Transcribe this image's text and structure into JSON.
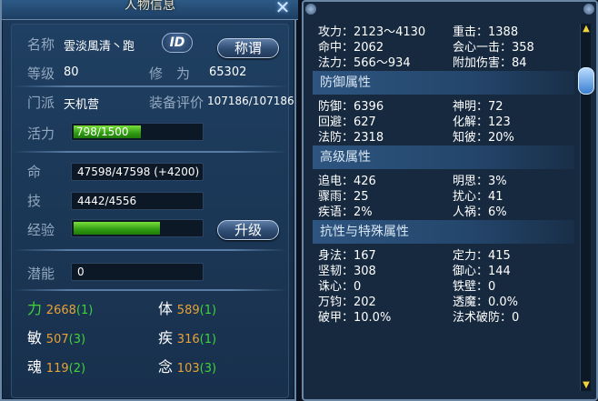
{
  "window": {
    "title": "人物信息",
    "close_icon": "close-x"
  },
  "profile": {
    "name_label": "名称",
    "name_value": "雲淡風清丶跑",
    "id_badge": "ID",
    "title_button": "称谓",
    "level_label": "等级",
    "level_value": "80",
    "cultivation_label": "修　为",
    "cultivation_value": "65302",
    "sect_label": "门派",
    "sect_value": "天机营",
    "gear_label": "装备评价",
    "gear_value": "107186/107186",
    "vitality_label": "活力",
    "vitality_value": "798/1500",
    "vitality_ratio": 0.532
  },
  "vitals": {
    "hp_label": "命",
    "hp_value": "47598/47598 (+4200)",
    "skill_label": "技",
    "skill_value": "4442/4556",
    "exp_label": "经验",
    "exp_ratio": 0.68,
    "upgrade_button": "升级",
    "potential_label": "潜能",
    "potential_value": "0"
  },
  "attributes": [
    {
      "name": "力",
      "value": "2668",
      "bonus": "(1)",
      "name_color": "#3fd43a"
    },
    {
      "name": "体",
      "value": "589",
      "bonus": "(1)",
      "name_color": "#ffffff"
    },
    {
      "name": "敏",
      "value": "507",
      "bonus": "(3)",
      "name_color": "#ffffff"
    },
    {
      "name": "疾",
      "value": "316",
      "bonus": "(1)",
      "name_color": "#ffffff"
    },
    {
      "name": "魂",
      "value": "119",
      "bonus": "(2)",
      "name_color": "#ffffff"
    },
    {
      "name": "念",
      "value": "103",
      "bonus": "(3)",
      "name_color": "#ffffff"
    }
  ],
  "colors": {
    "attr_value": "#e8a23a",
    "attr_bonus": "#3fd43a"
  },
  "stats": {
    "top": [
      [
        "攻力：2123～4130",
        "重击：1388"
      ],
      [
        "命中：2062",
        "会心一击：358"
      ],
      [
        "法力：566～934",
        "附加伤害：84"
      ]
    ],
    "defense_title": "防御属性",
    "defense": [
      [
        "防御：6396",
        "神明：72"
      ],
      [
        "回避：627",
        "化解：123"
      ],
      [
        "法防：2318",
        "知彼：20%"
      ]
    ],
    "advanced_title": "高级属性",
    "advanced": [
      [
        "追电：426",
        "明思：3%"
      ],
      [
        "骤雨：25",
        "扰心：41"
      ],
      [
        "疾语：2%",
        "人祸：6%"
      ]
    ],
    "resist_title": "抗性与特殊属性",
    "resist": [
      [
        "身法：167",
        "定力：415"
      ],
      [
        "坚韧：308",
        "御心：144"
      ],
      [
        "诛心：0",
        "铁壁：0"
      ],
      [
        "万钧：202",
        "透魔：0.0%"
      ],
      [
        "破甲：10.0%",
        "法术破防：0"
      ]
    ]
  }
}
